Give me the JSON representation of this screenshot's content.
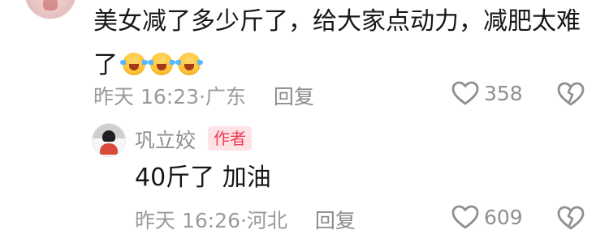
{
  "comment": {
    "text": "美女减了多少斤了，给大家点动力，减肥太难了",
    "emojis": [
      "crying-laughing-icon",
      "crying-laughing-icon",
      "crying-laughing-icon"
    ],
    "time": "昨天 16:23",
    "location": "广东",
    "reply_label": "回复",
    "likes": "358"
  },
  "reply": {
    "author_name": "巩立姣",
    "author_badge": "作者",
    "text": "40斤了 加油",
    "time": "昨天 16:26",
    "location": "河北",
    "reply_label": "回复",
    "likes": "609"
  },
  "colors": {
    "badge_bg": "#fde3e6",
    "badge_text": "#f03b56",
    "meta_text": "#9a9a9a",
    "primary_text": "#161616"
  }
}
